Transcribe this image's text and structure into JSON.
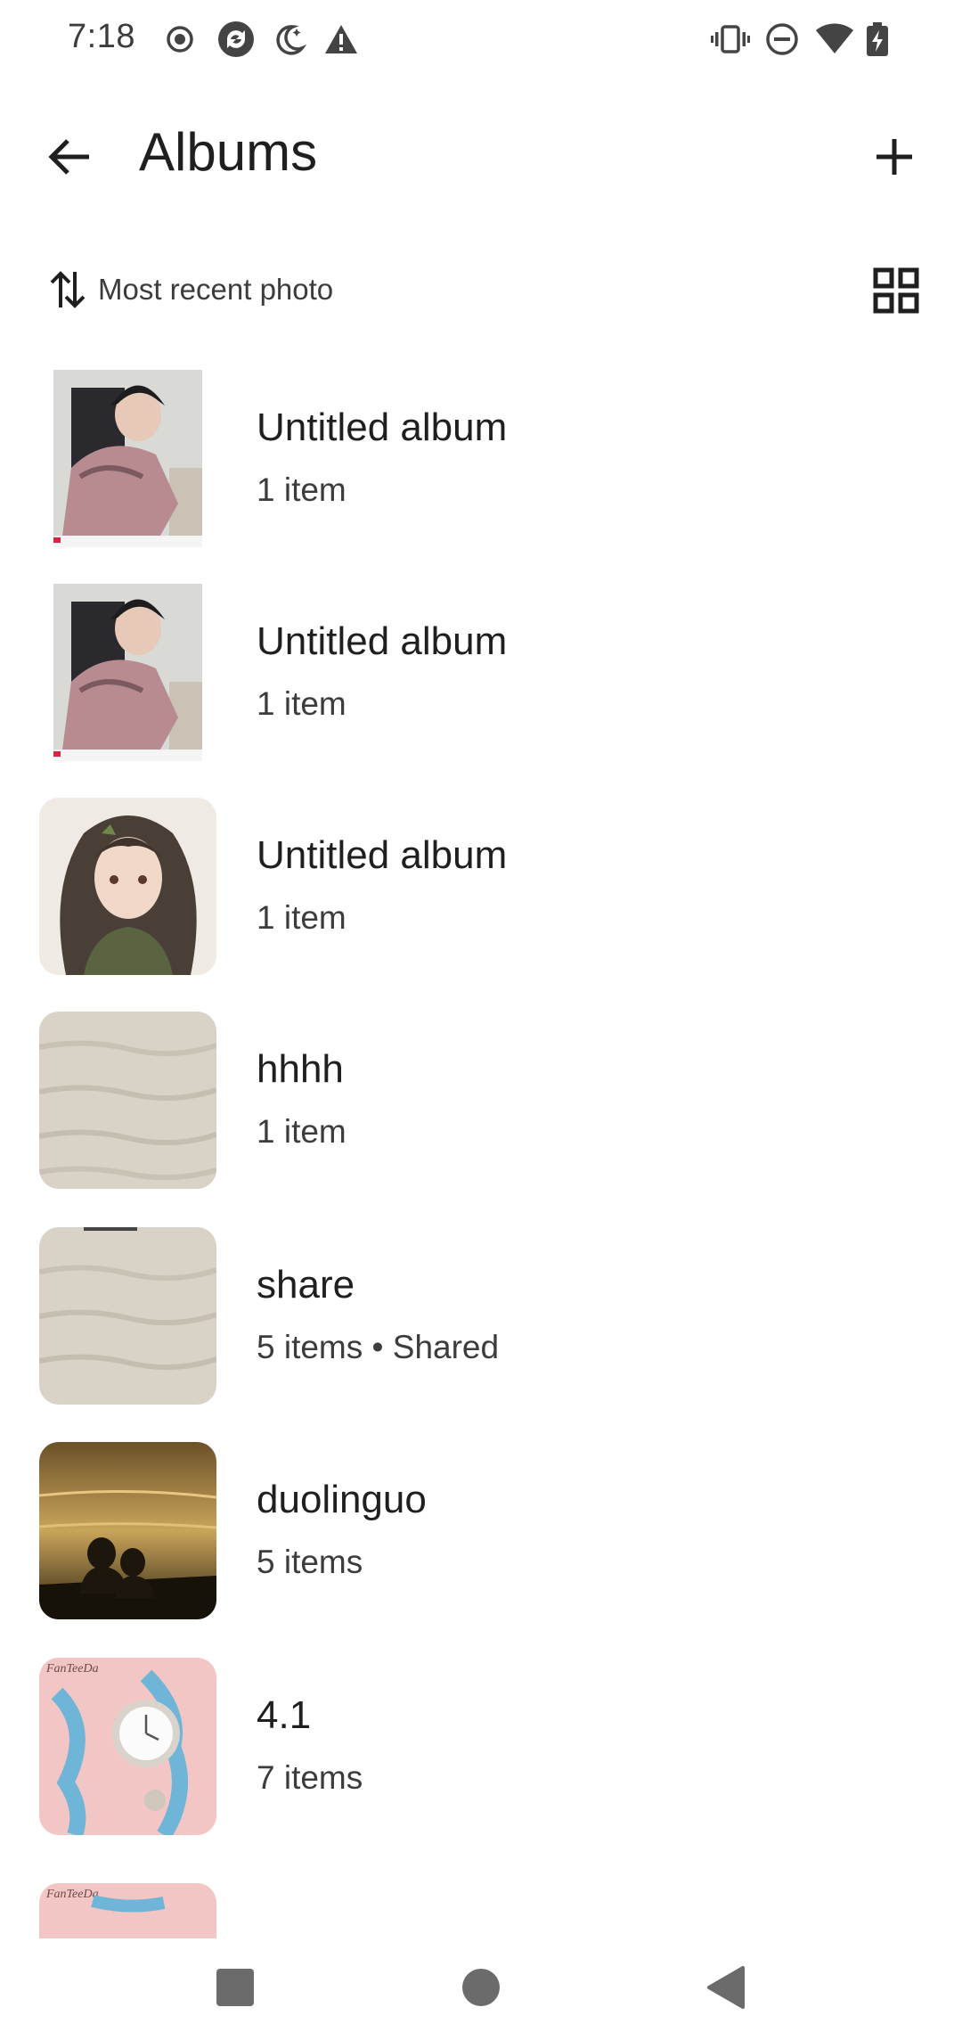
{
  "status_bar": {
    "time": "7:18",
    "left_icons": [
      "record-icon",
      "sync-icon",
      "night-mode-icon",
      "warning-icon"
    ],
    "right_icons": [
      "vibrate-icon",
      "do-not-disturb-icon",
      "wifi-icon",
      "battery-charging-icon"
    ]
  },
  "app_bar": {
    "title": "Albums",
    "back_icon": "arrow-back-icon",
    "add_icon": "plus-icon"
  },
  "sort": {
    "label": "Most recent photo",
    "icon": "sort-arrows-icon",
    "layout_icon": "grid-view-icon"
  },
  "albums": [
    {
      "title": "Untitled album",
      "subtitle": "1 item"
    },
    {
      "title": "Untitled album",
      "subtitle": "1 item"
    },
    {
      "title": "Untitled album",
      "subtitle": "1 item"
    },
    {
      "title": "hhhh",
      "subtitle": "1 item"
    },
    {
      "title": "share",
      "subtitle": "5 items • Shared"
    },
    {
      "title": "duolinguo",
      "subtitle": "5 items"
    },
    {
      "title": "4.1",
      "subtitle": "7 items"
    },
    {
      "title": "",
      "subtitle": ""
    }
  ],
  "thumb_watermark": "FanTeeDa",
  "nav_bar": {
    "buttons": [
      "recents-square-icon",
      "home-circle-icon",
      "back-triangle-icon"
    ]
  },
  "colors": {
    "text_primary": "#1f1f1f",
    "text_secondary": "#3c3c3c",
    "background": "#ffffff"
  }
}
